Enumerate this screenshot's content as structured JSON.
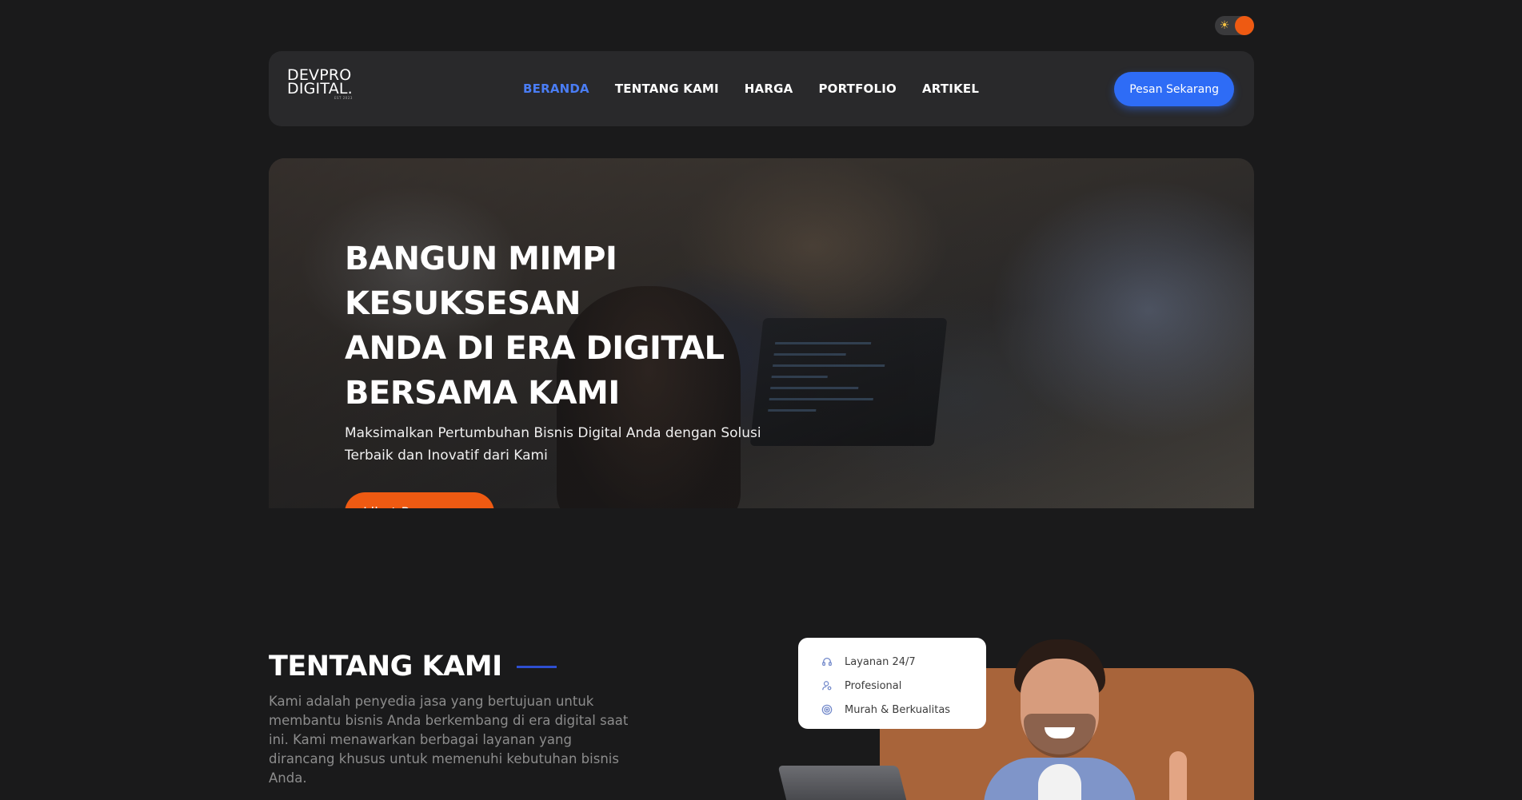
{
  "brand": {
    "logo_line1": "DEVPRO",
    "logo_line2": "DIGITAL.",
    "logo_tagline": "EST 2023",
    "primary_color": "#2e6cf6",
    "accent_color": "#ee5a12",
    "background_color": "#1a1a1b"
  },
  "theme_toggle": {
    "icon": "sun-icon",
    "state": "dark"
  },
  "nav": {
    "items": [
      {
        "label": "BERANDA",
        "active": true
      },
      {
        "label": "TENTANG KAMI",
        "active": false
      },
      {
        "label": "HARGA",
        "active": false
      },
      {
        "label": "PORTFOLIO",
        "active": false
      },
      {
        "label": "ARTIKEL",
        "active": false
      }
    ],
    "cta_label": "Pesan Sekarang"
  },
  "hero": {
    "title": "BANGUN MIMPI KESUKSESAN\nANDA DI ERA DIGITAL\nBERSAMA KAMI",
    "subtitle": "Maksimalkan Pertumbuhan Bisnis Digital Anda dengan Solusi Terbaik dan Inovatif dari Kami",
    "button_label": "Lihat Penawaran"
  },
  "about": {
    "title": "TENTANG KAMI",
    "text": "Kami adalah penyedia jasa yang bertujuan untuk membantu bisnis Anda berkembang di era digital saat ini. Kami menawarkan berbagai layanan yang dirancang khusus untuk memenuhi kebutuhan bisnis Anda.",
    "features": [
      {
        "label": "Layanan 24/7",
        "icon": "headset-icon"
      },
      {
        "label": "Profesional",
        "icon": "user-cog-icon"
      },
      {
        "label": "Murah & Berkualitas",
        "icon": "target-icon"
      }
    ]
  }
}
